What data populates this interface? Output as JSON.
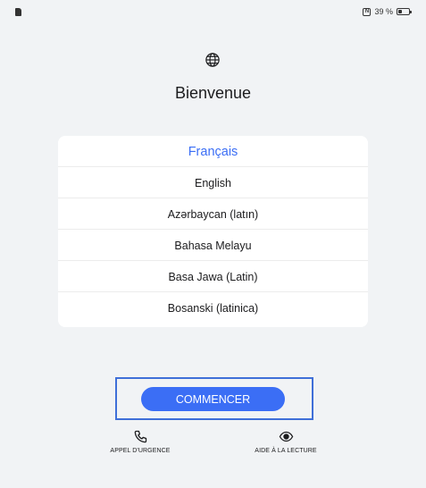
{
  "status_bar": {
    "battery_text": "39 %",
    "battery_level": 0.39,
    "nfc_label": "N"
  },
  "header": {
    "icon": "globe-icon",
    "title": "Bienvenue"
  },
  "languages": {
    "selected": "Français",
    "items": [
      "Français",
      "English",
      "Azərbaycan (latın)",
      "Bahasa Melayu",
      "Basa Jawa (Latin)",
      "Bosanski (latinica)"
    ]
  },
  "actions": {
    "start_label": "COMMENCER",
    "emergency_label": "APPEL D'URGENCE",
    "emergency_icon": "phone-icon",
    "reading_label": "AIDE À LA LECTURE",
    "reading_icon": "eye-icon"
  },
  "colors": {
    "accent": "#3b6ef5",
    "highlight_border": "#3f6fd8",
    "background": "#f1f3f5"
  }
}
